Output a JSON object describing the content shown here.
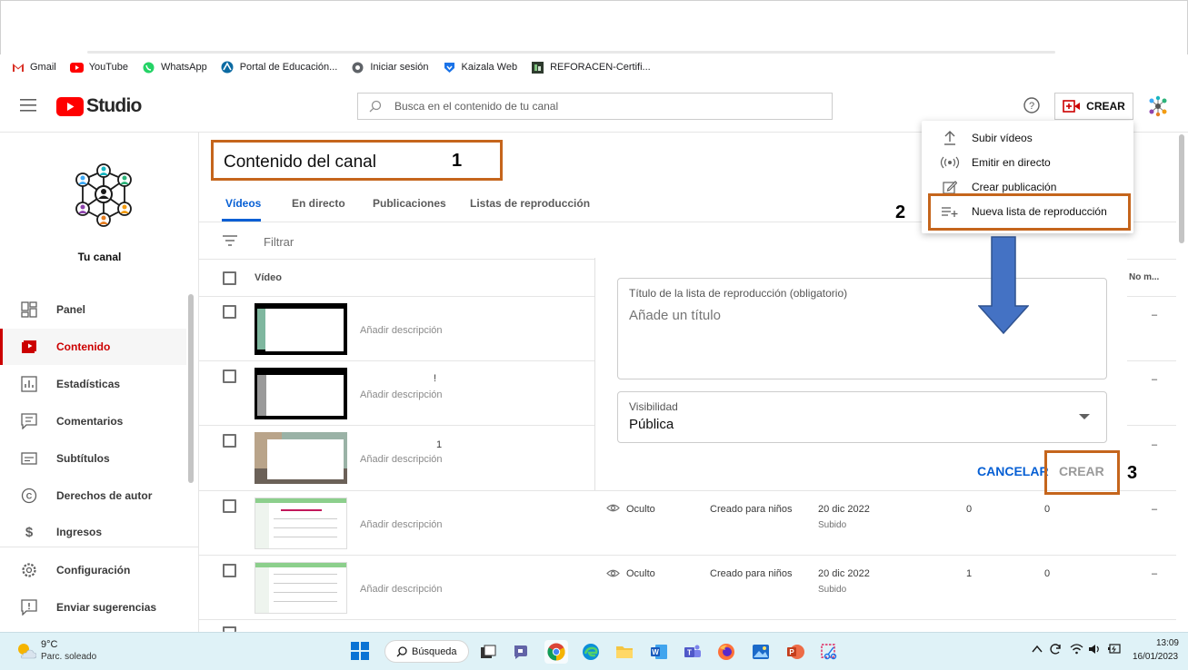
{
  "bookmarks": [
    {
      "label": "Gmail",
      "icon": "gmail-icon"
    },
    {
      "label": "YouTube",
      "icon": "youtube-icon"
    },
    {
      "label": "WhatsApp",
      "icon": "whatsapp-icon"
    },
    {
      "label": "Portal de Educación...",
      "icon": "portal-icon"
    },
    {
      "label": "Iniciar sesión",
      "icon": "globe-icon"
    },
    {
      "label": "Kaizala Web",
      "icon": "kaizala-icon"
    },
    {
      "label": "REFORACEN-Certifi...",
      "icon": "reforacen-icon"
    }
  ],
  "header": {
    "logo_text": "Studio",
    "search_placeholder": "Busca en el contenido de tu canal",
    "create_label": "CREAR"
  },
  "sidebar": {
    "channel_label": "Tu canal",
    "items": [
      {
        "label": "Panel",
        "icon": "dashboard-icon"
      },
      {
        "label": "Contenido",
        "icon": "content-icon",
        "active": true
      },
      {
        "label": "Estadísticas",
        "icon": "analytics-icon"
      },
      {
        "label": "Comentarios",
        "icon": "comments-icon"
      },
      {
        "label": "Subtítulos",
        "icon": "subtitles-icon"
      },
      {
        "label": "Derechos de autor",
        "icon": "copyright-icon"
      },
      {
        "label": "Ingresos",
        "icon": "dollar-icon"
      },
      {
        "label": "Configuración",
        "icon": "gear-icon"
      },
      {
        "label": "Enviar sugerencias",
        "icon": "feedback-icon"
      }
    ]
  },
  "main": {
    "page_title": "Contenido del canal",
    "tabs": [
      "Vídeos",
      "En directo",
      "Publicaciones",
      "Listas de reproducción"
    ],
    "filter_label": "Filtrar",
    "columns": {
      "video": "Vídeo",
      "no_monetized": "No m..."
    },
    "rows": [
      {
        "description": "Añadir descripción",
        "title_fragment": "",
        "visibility": "",
        "audience": "",
        "date": "",
        "date_sub": "",
        "views": "",
        "comments": "",
        "extra": "–"
      },
      {
        "description": "Añadir descripción",
        "title_fragment": "!",
        "visibility": "",
        "audience": "",
        "date": "",
        "date_sub": "",
        "views": "",
        "comments": "",
        "extra": "–"
      },
      {
        "description": "Añadir descripción",
        "title_fragment": "1",
        "visibility": "",
        "audience": "",
        "date": "",
        "date_sub": "",
        "views": "",
        "comments": "",
        "extra": "–"
      },
      {
        "description": "Añadir descripción",
        "title_fragment": "",
        "visibility": "Oculto",
        "audience": "Creado para niños",
        "date": "20 dic 2022",
        "date_sub": "Subido",
        "views": "0",
        "comments": "0",
        "extra": "–"
      },
      {
        "description": "Añadir descripción",
        "title_fragment": "",
        "visibility": "Oculto",
        "audience": "Creado para niños",
        "date": "20 dic 2022",
        "date_sub": "Subido",
        "views": "1",
        "comments": "0",
        "extra": "–"
      }
    ]
  },
  "playlist_dialog": {
    "title_label": "Título de la lista de reproducción (obligatorio)",
    "title_placeholder": "Añade un título",
    "visibility_label": "Visibilidad",
    "visibility_value": "Pública",
    "cancel_label": "CANCELAR",
    "create_label": "CREAR"
  },
  "create_menu": [
    {
      "label": "Subir vídeos",
      "icon": "upload-icon"
    },
    {
      "label": "Emitir en directo",
      "icon": "live-icon"
    },
    {
      "label": "Crear publicación",
      "icon": "edit-icon"
    },
    {
      "label": "Nueva lista de reproducción",
      "icon": "playlist-add-icon"
    }
  ],
  "annotations": [
    "1",
    "2",
    "3"
  ],
  "taskbar": {
    "weather_temp": "9°C",
    "weather_desc": "Parc. soleado",
    "search_label": "Búsqueda",
    "time": "13:09",
    "date": "16/01/2023"
  },
  "colors": {
    "brand_red": "#ff0000",
    "accent_blue": "#065fd4",
    "annotation_orange": "#c5651c",
    "arrow_blue": "#4472c4"
  }
}
